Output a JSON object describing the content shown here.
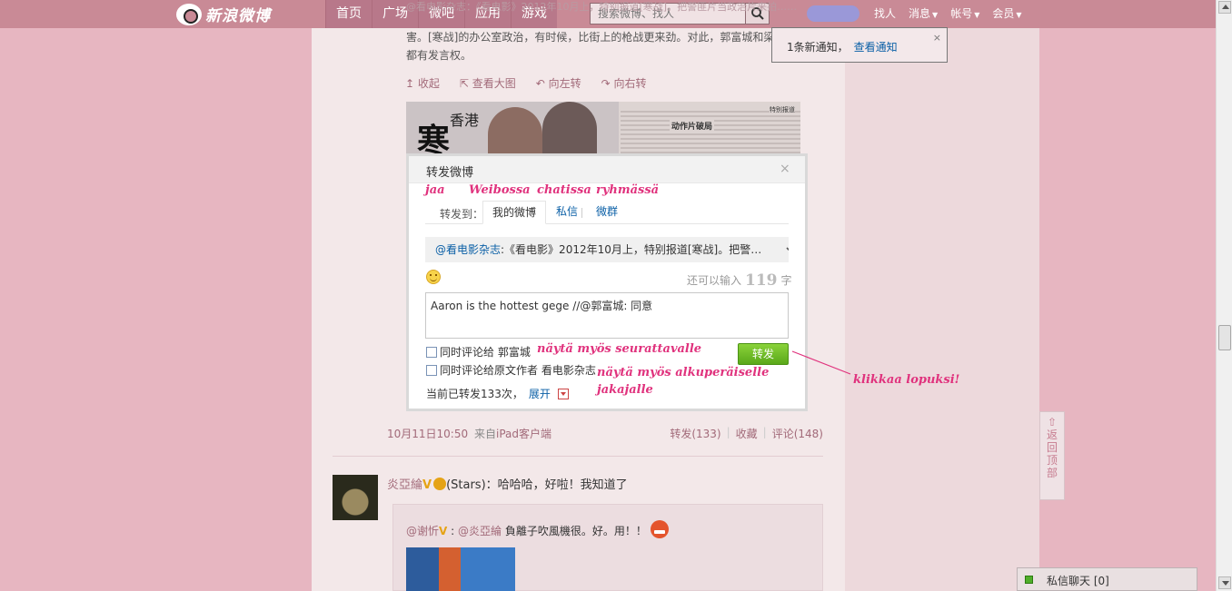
{
  "topbar": {
    "logo_text": "新浪微博",
    "nav": [
      "首页",
      "广场",
      "微吧",
      "应用",
      "游戏"
    ],
    "search_placeholder": "搜索微博、找人",
    "links": [
      {
        "label": "找人",
        "caret": false
      },
      {
        "label": "消息",
        "caret": true
      },
      {
        "label": "帐号",
        "caret": true
      },
      {
        "label": "会员",
        "caret": true
      }
    ]
  },
  "feed": {
    "ghost_text": "@看电影杂志：《看电影》2012年10月上，特别报道[寒战]。把警匪片当政治片来拍……",
    "post_text": "害。[寒战]的办公室政治，有时候，比街上的枪战更来劲。对此，郭富城和梁家辉都有发言权。",
    "image_actions": [
      "↥ 收起",
      "⇱ 查看大图",
      "↶ 向左转",
      "↷ 向右转"
    ],
    "image": {
      "big_char": "寒",
      "small_chars": "香港",
      "headline": "动作片破局",
      "tag": "特别报道"
    },
    "meta": {
      "time": "10月11日10:50",
      "from_prefix": "来自",
      "from_app": "iPad客户端",
      "repost": "转发(133)",
      "favorite": "收藏",
      "comment": "评论(148)"
    },
    "post2": {
      "user": "炎亞綸",
      "badge": "V",
      "text": "(Stars)：哈哈哈，好啦！我知道了",
      "repost_user": "@谢忻",
      "repost_badge": "V",
      "repost_mention": "@炎亞綸",
      "repost_text": "負離子吹風機很。好。用！！"
    }
  },
  "notification": {
    "text": "1条新通知，",
    "link": "查看通知",
    "close": "×"
  },
  "back_to_top": {
    "arrow": "⇧",
    "chars": [
      "返",
      "回",
      "顶",
      "部"
    ]
  },
  "chat": {
    "label": "私信聊天 [0]"
  },
  "dialog": {
    "title": "转发微博",
    "close": "×",
    "tab_prefix": "转发到：",
    "tabs": [
      "我的微博",
      "私信",
      "微群"
    ],
    "quote_user": "@看电影杂志",
    "quote_text": ":《看电影》2012年10月上，特别报道[寒战]。把警…",
    "counter_prefix": "还可以输入",
    "counter_value": "119",
    "counter_suffix": "字",
    "textarea_value": "Aaron is the hottest gege //@郭富城: 同意",
    "checkbox1": "同时评论给 郭富城",
    "checkbox2": "同时评论给原文作者 看电影杂志",
    "send_label": "转发",
    "repost_count": "当前已转发133次，",
    "expand": "展开"
  },
  "annotations": {
    "jaa": "jaa",
    "weibossa": "Weibossa",
    "chatissa": "chatissa",
    "ryhmassa": "ryhmässä",
    "follower": "näytä myös seurattavalle",
    "original_1": "näytä myös alkuperäiselle",
    "original_2": "jakajalle",
    "click": "klikkaa lopuksi!",
    "color": "#e0327d"
  }
}
